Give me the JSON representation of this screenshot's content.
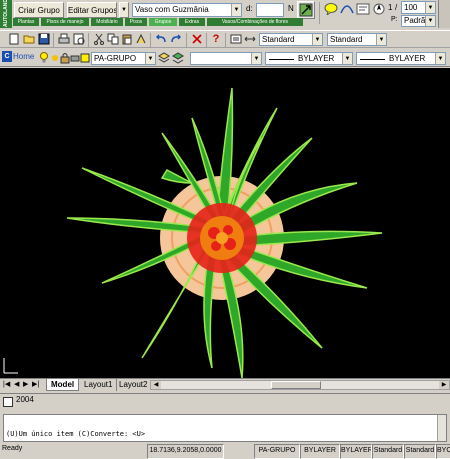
{
  "logo": {
    "text": "AUTOLAND"
  },
  "group_toolbar": {
    "create_group": "Criar Grupo",
    "edit_groups": "Editar Grupos",
    "group_select": "Vaso com Guzmânia",
    "d_label": "d:",
    "d_value": "",
    "n_label": "N"
  },
  "palette_tabs": [
    "Plantas",
    "Pisos de manejo",
    "Mobiliário",
    "Pisos",
    "Grupos",
    "Extras",
    "Vasos/Combinações de flores"
  ],
  "scale": {
    "page_value": "1",
    "sep": "/",
    "total_value": "100",
    "p_label": "P:",
    "preset_value": "Padrão"
  },
  "std_toolbar": {
    "text_style": "Standard",
    "dim_style": "Standard"
  },
  "layer_toolbar": {
    "home_label": "Home",
    "layer_value": "PA-GRUPO",
    "linetype_1": "BYLAYER",
    "linetype_2": "BYLAYER"
  },
  "layout_tabs": [
    "Model",
    "Layout1",
    "Layout2"
  ],
  "colors": {
    "canvas_bg": "#000000",
    "leaf_green": "#2fa82a",
    "leaf_outline": "#9be84d",
    "pot_color": "#f5c69a",
    "flower_red": "#e8201a",
    "flower_orange": "#f07d10",
    "logo_green": "#2e7d32"
  },
  "history": {
    "line1": "2004"
  },
  "command": {
    "prompt": "(U)Um único item (C)Converte: <U>"
  },
  "status_bar": {
    "ready": "Ready",
    "coords": "18.7136,9.2058,0.0000",
    "layer": "PA-GRUPO",
    "color": "BYLAYER",
    "linetype": "BYLAYER",
    "textstyle": "Standard",
    "dimstyle": "Standard",
    "last": "BYCO"
  }
}
